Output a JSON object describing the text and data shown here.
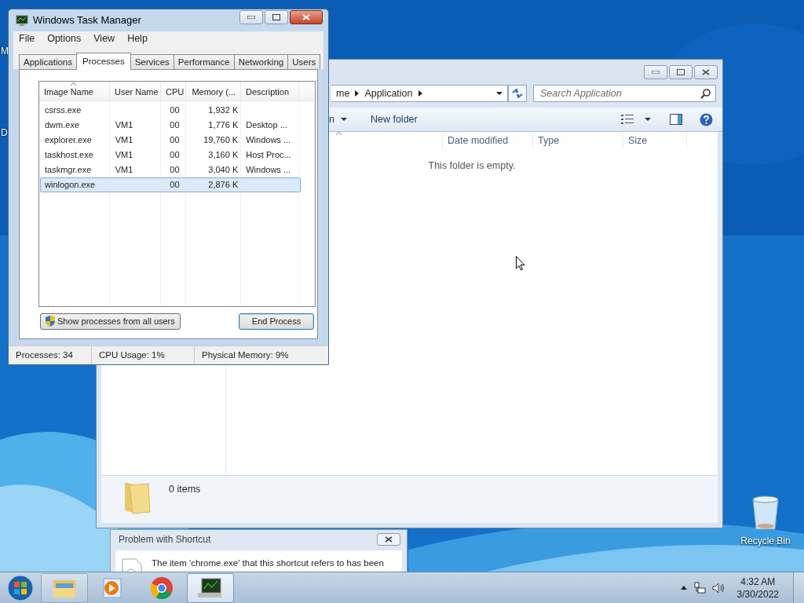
{
  "desktop": {
    "icon_label_fragments": [
      "M",
      "D"
    ],
    "recycle_bin": {
      "label": "Recycle Bin"
    }
  },
  "explorer": {
    "breadcrumb": [
      "me",
      "Application"
    ],
    "search": {
      "placeholder": "Search Application"
    },
    "toolbar": [
      {
        "label": "n",
        "dropdown": true
      },
      {
        "label": "New folder",
        "dropdown": false
      }
    ],
    "columns": [
      {
        "label": "Date modified"
      },
      {
        "label": "Type"
      },
      {
        "label": "Size"
      }
    ],
    "empty_message": "This folder is empty.",
    "status": "0 items"
  },
  "task_manager": {
    "title": "Windows Task Manager",
    "menu": [
      "File",
      "Options",
      "View",
      "Help"
    ],
    "tabs": [
      {
        "label": "Applications",
        "selected": false
      },
      {
        "label": "Processes",
        "selected": true
      },
      {
        "label": "Services",
        "selected": false
      },
      {
        "label": "Performance",
        "selected": false
      },
      {
        "label": "Networking",
        "selected": false
      },
      {
        "label": "Users",
        "selected": false
      }
    ],
    "columns": [
      {
        "label": "Image Name",
        "sorted": true
      },
      {
        "label": "User Name",
        "sorted": false
      },
      {
        "label": "CPU",
        "sorted": false
      },
      {
        "label": "Memory (...",
        "sorted": false
      },
      {
        "label": "Description",
        "sorted": false
      }
    ],
    "rows": [
      {
        "cells": [
          "csrss.exe",
          "",
          "00",
          "1,932 K",
          ""
        ],
        "selected": false
      },
      {
        "cells": [
          "dwm.exe",
          "VM1",
          "00",
          "1,776 K",
          "Desktop ..."
        ],
        "selected": false
      },
      {
        "cells": [
          "explorer.exe",
          "VM1",
          "00",
          "19,760 K",
          "Windows ..."
        ],
        "selected": false
      },
      {
        "cells": [
          "taskhost.exe",
          "VM1",
          "00",
          "3,160 K",
          "Host Proc..."
        ],
        "selected": false
      },
      {
        "cells": [
          "taskmgr.exe",
          "VM1",
          "00",
          "3,040 K",
          "Windows ..."
        ],
        "selected": false
      },
      {
        "cells": [
          "winlogon.exe",
          "",
          "00",
          "2,876 K",
          ""
        ],
        "selected": true
      }
    ],
    "show_all_button": "Show processes from all users",
    "end_button": "End Process",
    "status_bar": [
      "Processes: 34",
      "CPU Usage: 1%",
      "Physical Memory: 9%"
    ]
  },
  "dialog": {
    "title": "Problem with Shortcut",
    "message": "The item 'chrome.exe' that this shortcut refers to has been"
  },
  "taskbar": {
    "apps": [
      {
        "kind": "explorer",
        "running": true,
        "selected": false
      },
      {
        "kind": "media",
        "running": false,
        "selected": false
      },
      {
        "kind": "chrome",
        "running": false,
        "selected": false
      },
      {
        "kind": "taskmgr",
        "running": true,
        "selected": true
      }
    ],
    "clock": {
      "time": "4:32 AM",
      "date": "3/30/2022"
    }
  }
}
